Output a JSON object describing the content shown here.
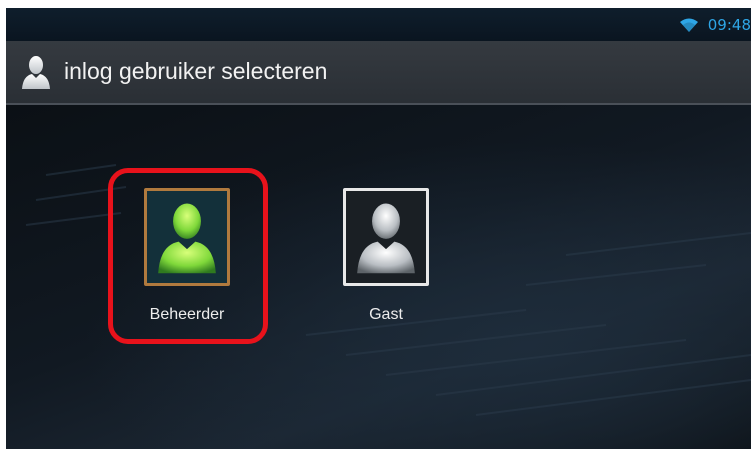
{
  "status_bar": {
    "time": "09:48",
    "wifi_icon": "wifi-icon",
    "accent_color": "#2ea6e6"
  },
  "title_bar": {
    "icon": "user-icon",
    "title": "inlog gebruiker selecteren"
  },
  "users": [
    {
      "label": "Beheerder",
      "icon": "user-avatar-icon",
      "avatar_color": "#8fe04a",
      "frame_color": "#b07a3e",
      "selected": true
    },
    {
      "label": "Gast",
      "icon": "user-avatar-icon",
      "avatar_color": "#c8c8c8",
      "frame_color": "#e8e8e8",
      "selected": false
    }
  ],
  "highlight": {
    "color": "#e8121b"
  }
}
